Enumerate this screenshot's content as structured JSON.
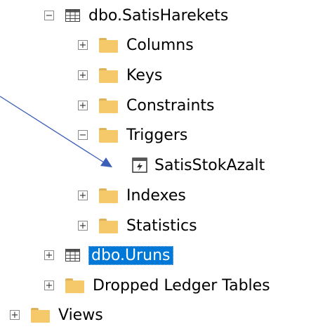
{
  "tree": {
    "table1": {
      "label": "dbo.SatisHarekets",
      "expander": "−"
    },
    "columns": {
      "label": "Columns",
      "expander": "+"
    },
    "keys": {
      "label": "Keys",
      "expander": "+"
    },
    "constraints": {
      "label": "Constraints",
      "expander": "+"
    },
    "triggers": {
      "label": "Triggers",
      "expander": "−"
    },
    "trigger_item": {
      "label": "SatisStokAzalt"
    },
    "indexes": {
      "label": "Indexes",
      "expander": "+"
    },
    "statistics": {
      "label": "Statistics",
      "expander": "+"
    },
    "table2": {
      "label": "dbo.Uruns",
      "expander": "+"
    },
    "dropped": {
      "label": "Dropped Ledger Tables",
      "expander": "+"
    },
    "views": {
      "label": "Views",
      "expander": "+"
    }
  },
  "colors": {
    "selection": "#0078d7",
    "folder": "#f5c86a",
    "arrow": "#3b5fb7"
  }
}
